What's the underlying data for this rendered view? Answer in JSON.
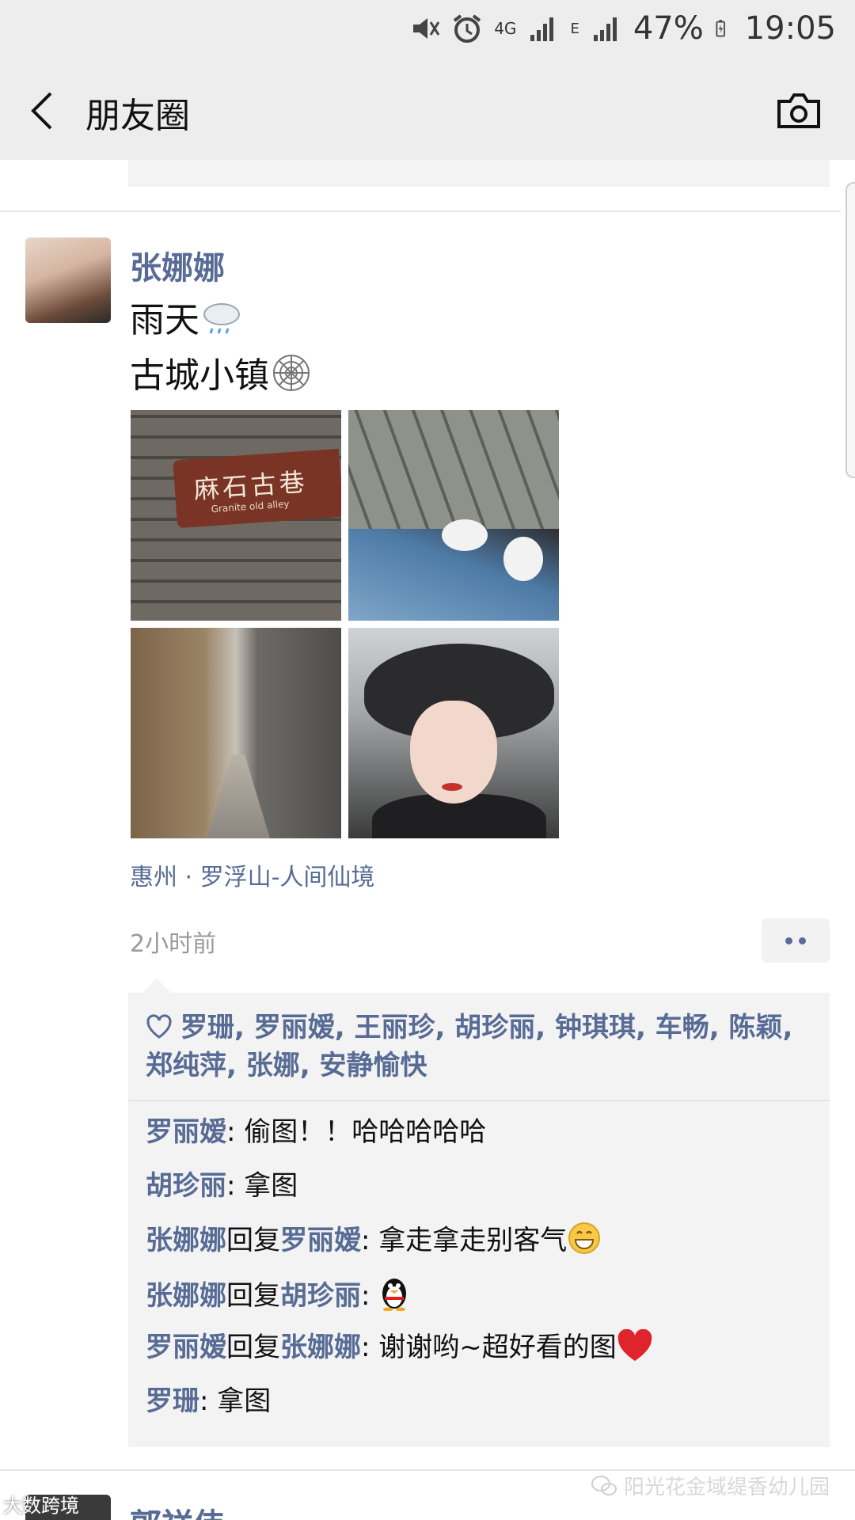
{
  "status_bar": {
    "network": "4G",
    "network2": "E",
    "battery": "47%",
    "time": "19:05"
  },
  "header": {
    "title": "朋友圈"
  },
  "post": {
    "author": "张娜娜",
    "text_line1": "雨天",
    "text_line2": "古城小镇",
    "photo1_sign": "麻石古巷",
    "photo1_sign_sub": "Granite old alley",
    "location": "惠州 · 罗浮山-人间仙境",
    "time_ago": "2小时前",
    "likes": "罗珊, 罗丽嫒, 王丽珍, 胡珍丽, 钟琪琪, 车畅, 陈颖, 郑纯萍, 张娜, 安静愉快",
    "comments": [
      {
        "name": "罗丽嫒",
        "reply_to": "",
        "text": "偷图！！哈哈哈哈哈"
      },
      {
        "name": "胡珍丽",
        "reply_to": "",
        "text": "拿图"
      },
      {
        "name": "张娜娜",
        "reply_word": "回复",
        "reply_to": "罗丽嫒",
        "text": "拿走拿走别客气"
      },
      {
        "name": "张娜娜",
        "reply_word": "回复",
        "reply_to": "胡珍丽",
        "text": ""
      },
      {
        "name": "罗丽嫒",
        "reply_word": "回复",
        "reply_to": "张娜娜",
        "text": "谢谢哟~超好看的图"
      },
      {
        "name": "罗珊",
        "reply_to": "",
        "text": "拿图"
      }
    ]
  },
  "next_post": {
    "author": "郭祥伟"
  },
  "watermarks": {
    "left": "大数跨境",
    "right": "阳光花金域缇香幼儿园"
  },
  "colors": {
    "link": "#576b95",
    "bar_bg": "#ededed",
    "comment_bg": "#f3f3f3"
  }
}
